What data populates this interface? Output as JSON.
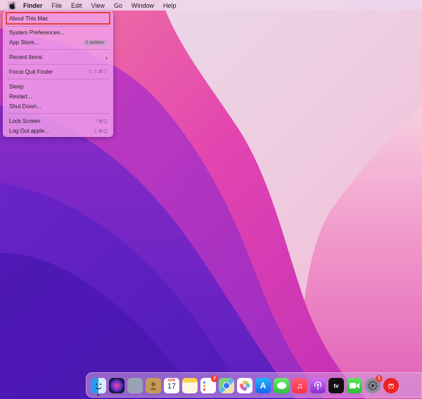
{
  "menubar": {
    "apple_icon": "apple-logo-icon",
    "items": [
      "Finder",
      "File",
      "Edit",
      "View",
      "Go",
      "Window",
      "Help"
    ]
  },
  "apple_menu": {
    "about": "About This Mac",
    "system_preferences": "System Preferences...",
    "app_store": "App Store...",
    "app_store_badge": "3 updates",
    "recent_items": "Recent Items",
    "force_quit": "Force Quit Finder",
    "force_quit_shortcut": "⌥⇧⌘⎋",
    "sleep": "Sleep",
    "restart": "Restart...",
    "shut_down": "Shut Down...",
    "lock_screen": "Lock Screen",
    "lock_screen_shortcut": "^⌘Q",
    "log_out": "Log Out apple...",
    "log_out_shortcut": "⇧⌘Q",
    "highlight_color": "#e2433c"
  },
  "dock": {
    "calendar_month": "APR",
    "calendar_day": "17",
    "reminders_badge": "2",
    "system_prefs_badge": "1",
    "apple_tv_label": "tv",
    "icons": [
      "finder-icon",
      "siri-icon",
      "launchpad-icon",
      "contacts-icon",
      "calendar-icon",
      "notes-icon",
      "reminders-icon",
      "maps-icon",
      "photos-icon",
      "app-store-icon",
      "messages-icon",
      "music-icon",
      "podcasts-icon",
      "apple-tv-icon",
      "facetime-icon",
      "system-preferences-icon",
      "netease-music-icon"
    ]
  },
  "colors": {
    "menubar_bg": "#eed6ec",
    "menu_bg": "#f0a0ec",
    "wallpaper_dark": "#5a1fc0",
    "wallpaper_pink": "#e04db5"
  }
}
